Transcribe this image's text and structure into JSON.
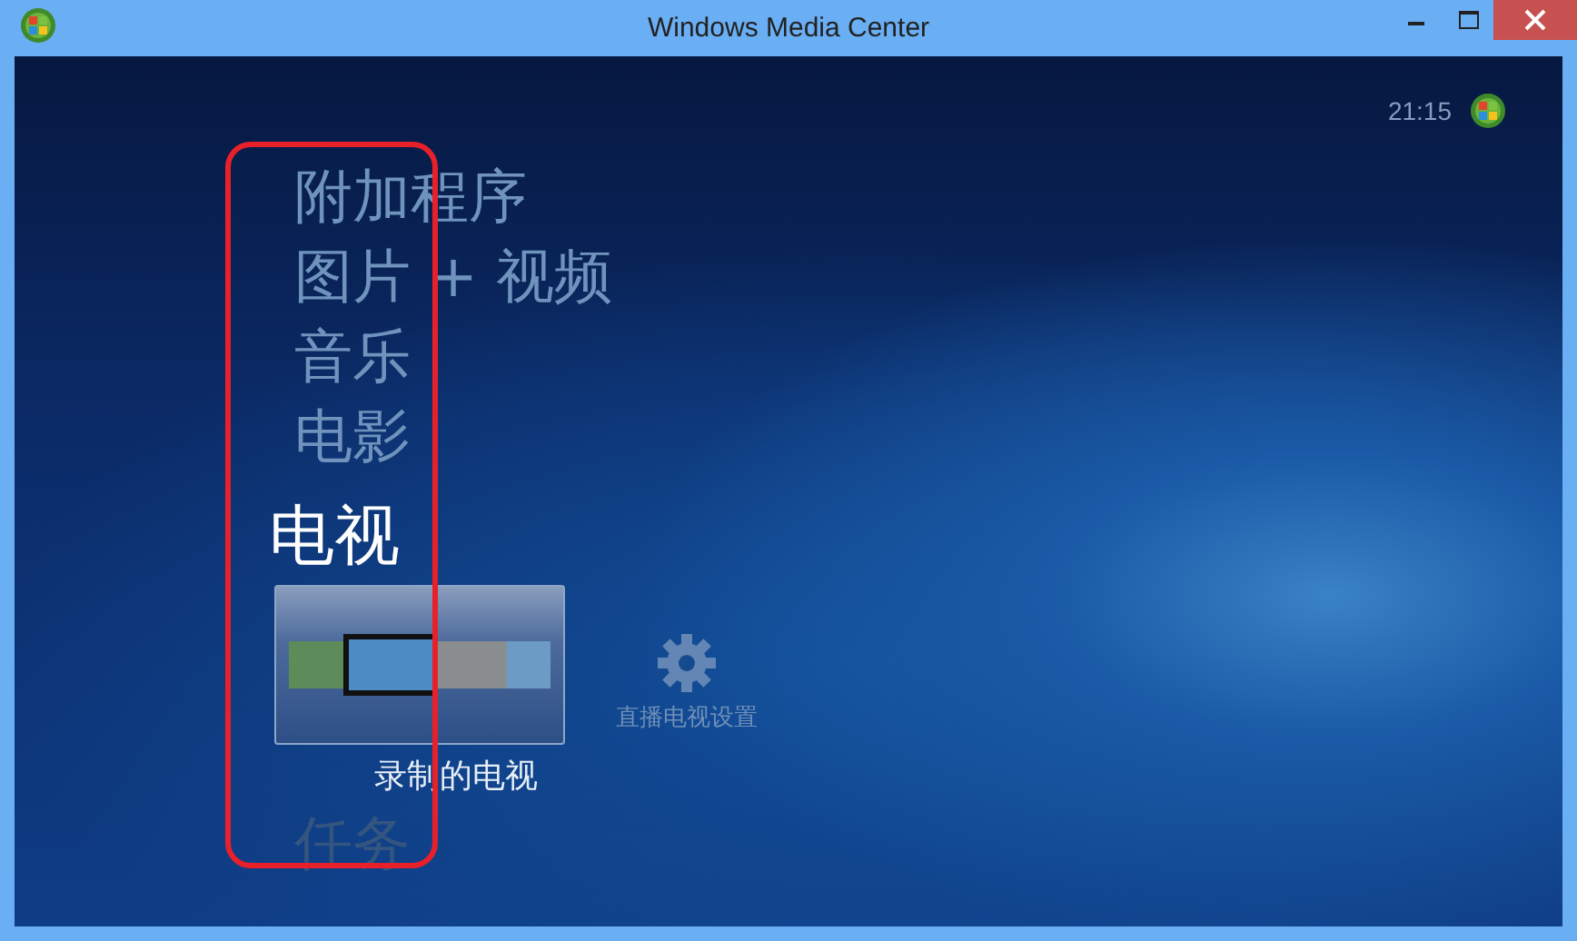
{
  "window": {
    "title": "Windows Media Center"
  },
  "clock": "21:15",
  "menu": [
    {
      "label": "附加程序",
      "selected": false
    },
    {
      "label": "图片 + 视频",
      "selected": false
    },
    {
      "label": "音乐",
      "selected": false
    },
    {
      "label": "电影",
      "selected": false
    },
    {
      "label": "电视",
      "selected": true,
      "tiles": [
        {
          "kind": "thumbnails",
          "label": "录制的电视",
          "selected": true
        },
        {
          "kind": "settings",
          "label": "直播电视设置",
          "selected": false
        }
      ]
    },
    {
      "label": "任务",
      "selected": false
    }
  ],
  "highlight": {
    "color": "#e8202a"
  }
}
